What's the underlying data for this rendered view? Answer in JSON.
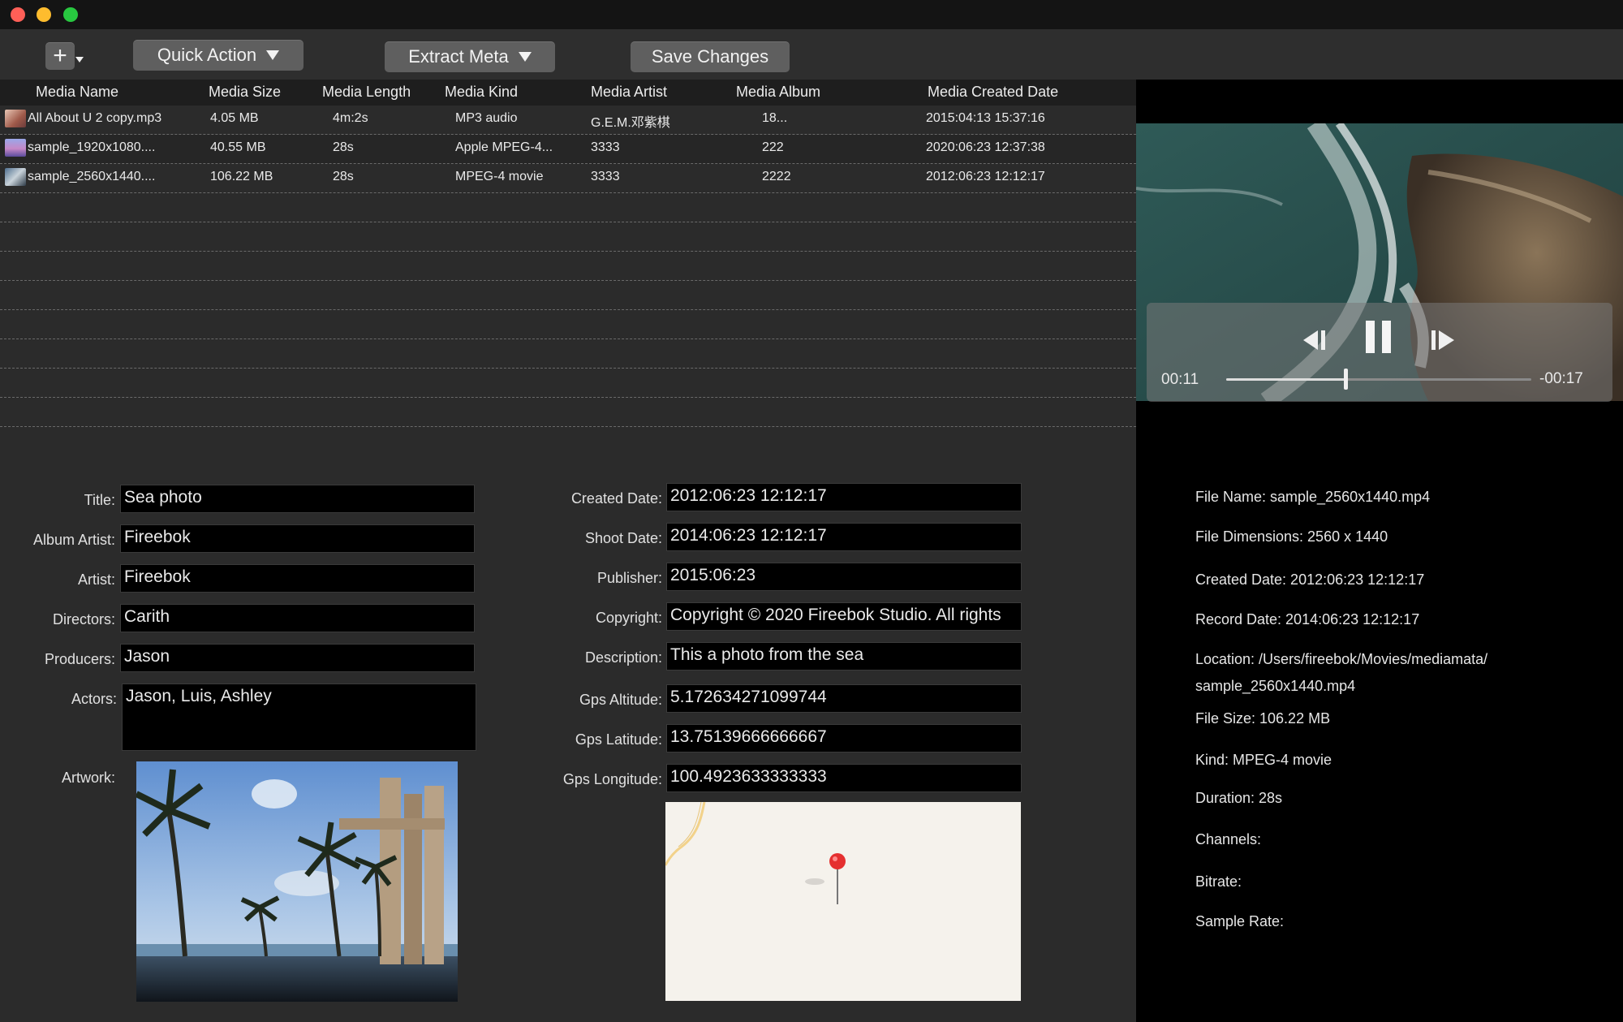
{
  "toolbar": {
    "add_label": "+",
    "quick_action_label": "Quick Action",
    "extract_meta_label": "Extract Meta",
    "save_changes_label": "Save Changes"
  },
  "table": {
    "columns": [
      "Media Name",
      "Media Size",
      "Media Length",
      "Media Kind",
      "Media Artist",
      "Media Album",
      "Media Created Date"
    ],
    "rows": [
      {
        "name": "All About U 2 copy.mp3",
        "size": "4.05 MB",
        "length": "4m:2s",
        "kind": "MP3 audio",
        "artist": "G.E.M.邓紫棋",
        "album": "18...",
        "created": "2015:04:13 15:37:16"
      },
      {
        "name": "sample_1920x1080....",
        "size": "40.55 MB",
        "length": "28s",
        "kind": "Apple MPEG-4...",
        "artist": "3333",
        "album": "222",
        "created": "2020:06:23 12:37:38"
      },
      {
        "name": "sample_2560x1440....",
        "size": "106.22 MB",
        "length": "28s",
        "kind": "MPEG-4 movie",
        "artist": "3333",
        "album": "2222",
        "created": "2012:06:23 12:12:17"
      }
    ]
  },
  "form": {
    "title": {
      "label": "Title:",
      "value": "Sea photo"
    },
    "album_artist": {
      "label": "Album Artist:",
      "value": "Fireebok"
    },
    "artist": {
      "label": "Artist:",
      "value": "Fireebok"
    },
    "directors": {
      "label": "Directors:",
      "value": "Carith"
    },
    "producers": {
      "label": "Producers:",
      "value": "Jason"
    },
    "actors": {
      "label": "Actors:",
      "value": "Jason, Luis, Ashley"
    },
    "artwork_label": "Artwork:",
    "created_date": {
      "label": "Created Date:",
      "value": "2012:06:23 12:12:17"
    },
    "shoot_date": {
      "label": "Shoot Date:",
      "value": "2014:06:23 12:12:17"
    },
    "publisher": {
      "label": "Publisher:",
      "value": "2015:06:23"
    },
    "copyright": {
      "label": "Copyright:",
      "value": "Copyright © 2020 Fireebok Studio. All rights"
    },
    "description": {
      "label": "Description:",
      "value": "This a photo from the sea"
    },
    "gps_altitude": {
      "label": "Gps Altitude:",
      "value": "5.172634271099744"
    },
    "gps_latitude": {
      "label": "Gps Latitude:",
      "value": "13.75139666666667"
    },
    "gps_longitude": {
      "label": "Gps Longitude:",
      "value": "100.4923633333333"
    }
  },
  "player": {
    "elapsed": "00:11",
    "remaining": "-00:17",
    "progress_fraction": 0.39
  },
  "info": {
    "file_name": "File Name: sample_2560x1440.mp4",
    "file_dimensions": "File Dimensions: 2560 x 1440",
    "created_date": "Created Date: 2012:06:23 12:12:17",
    "record_date": "Record Date: 2014:06:23 12:12:17",
    "location_line1": "Location: /Users/fireebok/Movies/mediamata/",
    "location_line2": "sample_2560x1440.mp4",
    "file_size": "File Size: 106.22 MB",
    "kind": "Kind: MPEG-4 movie",
    "duration": "Duration: 28s",
    "channels": "Channels:",
    "bitrate": "Bitrate:",
    "sample_rate": "Sample Rate:"
  },
  "colors": {
    "window_bg": "#2b2b2b",
    "button_bg": "#5f5f5f",
    "field_bg": "#000000",
    "map_pin": "#e53030"
  }
}
